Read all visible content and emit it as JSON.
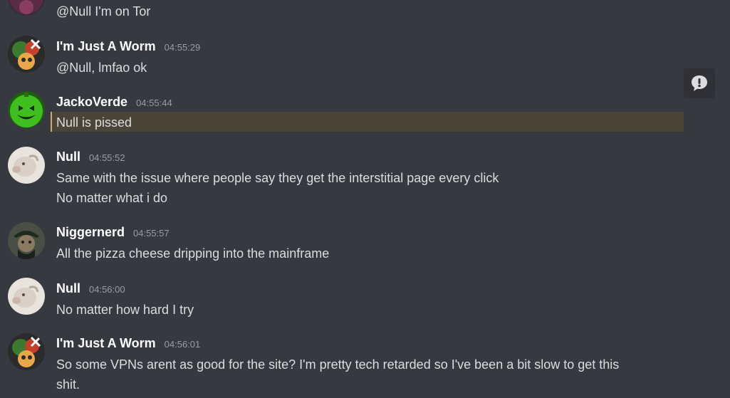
{
  "messages": [
    {
      "author": "",
      "timestamp": "",
      "lines": [
        "@Null I'm on Tor"
      ]
    },
    {
      "author": "I'm Just A Worm",
      "timestamp": "04:55:29",
      "lines": [
        "@Null, lmfao ok"
      ]
    },
    {
      "author": "JackoVerde",
      "timestamp": "04:55:44",
      "lines": [
        "Null is pissed"
      ]
    },
    {
      "author": "Null",
      "timestamp": "04:55:52",
      "lines": [
        "Same with the issue where people say they get the interstitial page every click",
        "No matter what i do"
      ]
    },
    {
      "author": "Niggernerd",
      "timestamp": "04:55:57",
      "lines": [
        "All the pizza cheese dripping into the mainframe"
      ]
    },
    {
      "author": "Null",
      "timestamp": "04:56:00",
      "lines": [
        "No matter how hard I try"
      ]
    },
    {
      "author": "I'm Just A Worm",
      "timestamp": "04:56:01",
      "lines": [
        "So some VPNs arent as good for the site? I'm pretty tech retarded so I've been a bit slow to get this",
        "shit."
      ]
    }
  ],
  "side_button": {
    "icon": "exclamation-speech-bubble-icon"
  },
  "colors": {
    "background": "#36393f",
    "author": "#ffffff",
    "text": "#dcddde",
    "timestamp": "#9a9ca2",
    "highlight_bg": "#4a4537",
    "highlight_border": "#c9aa71"
  }
}
